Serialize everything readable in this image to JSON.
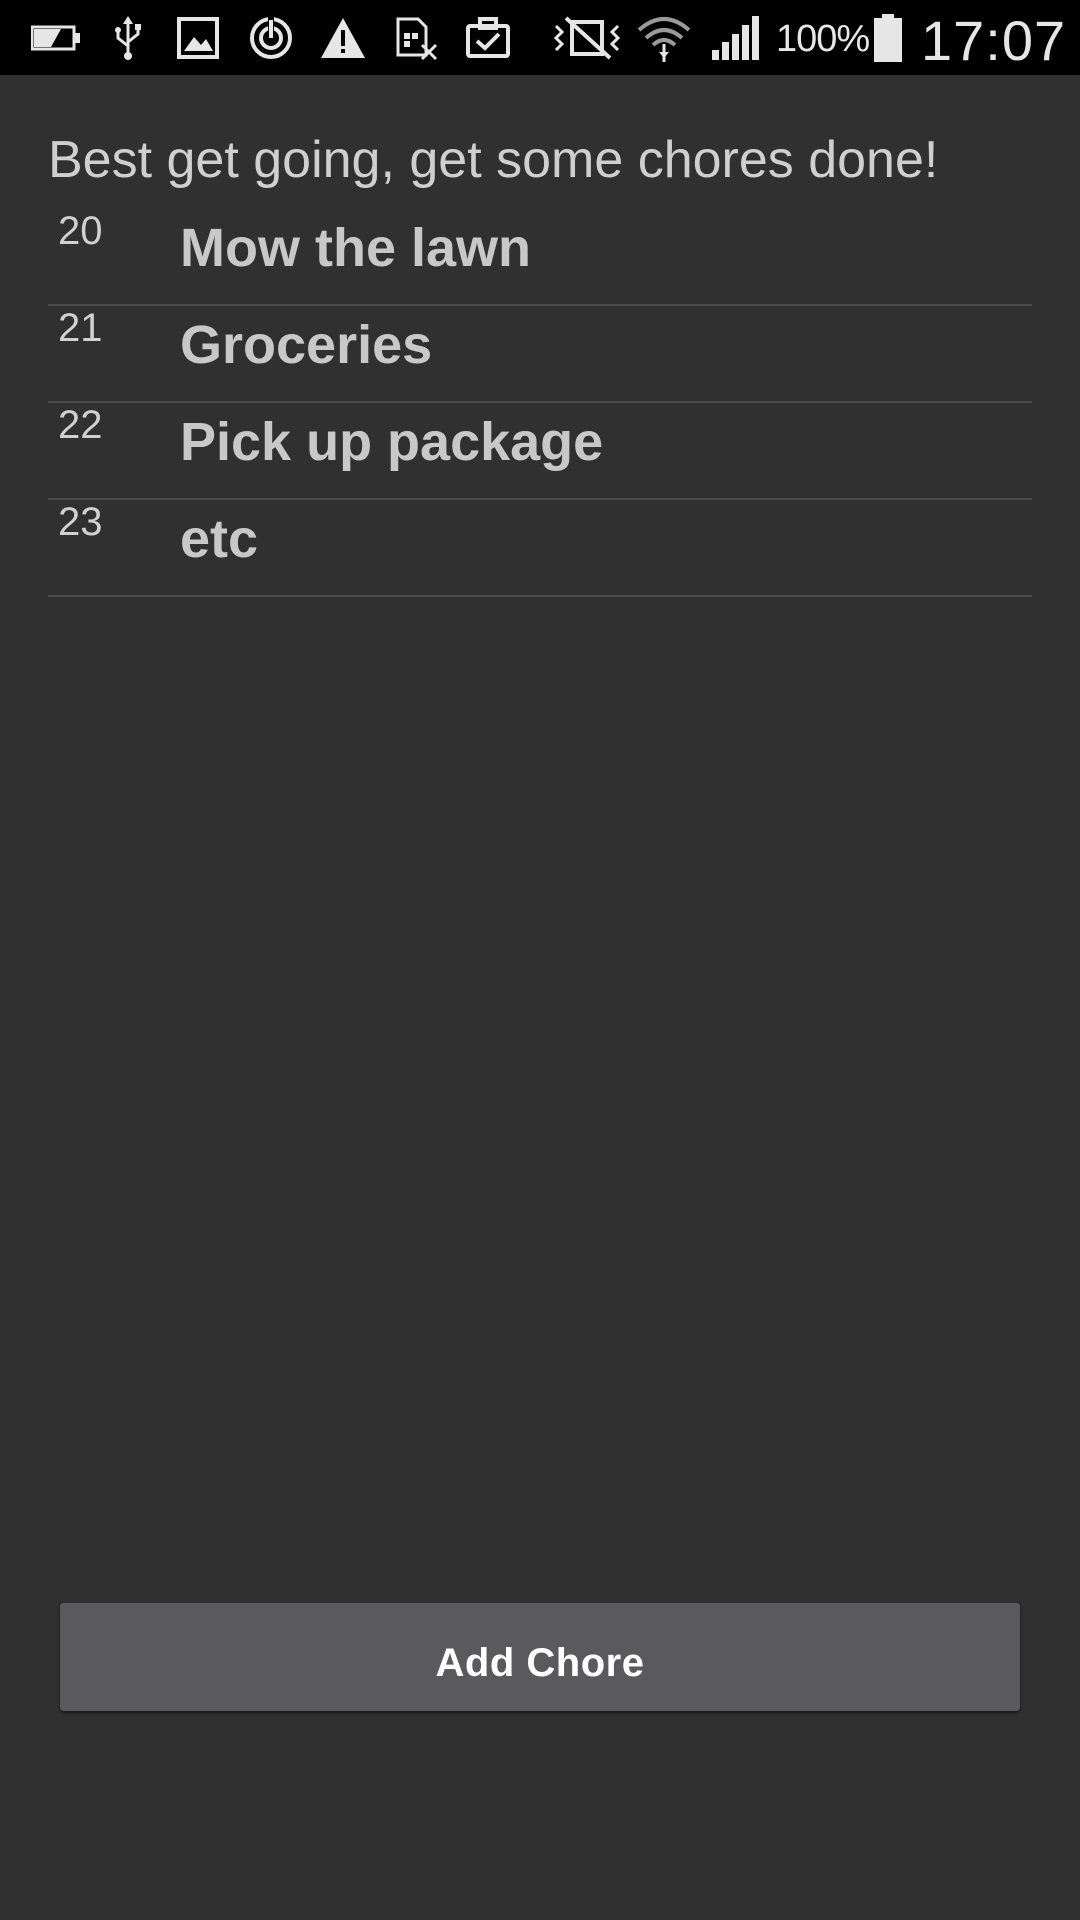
{
  "status_bar": {
    "battery_percent": "100%",
    "time": "17:07",
    "icons": [
      "battery-low-icon",
      "usb-icon",
      "image-icon",
      "sync-icon",
      "warning-icon",
      "sim-error-icon",
      "clipboard-check-icon",
      "vibrate-icon",
      "wifi-icon",
      "signal-icon",
      "battery-icon"
    ]
  },
  "header": {
    "text": "Best get going, get some chores done!"
  },
  "chores": [
    {
      "id": "20",
      "title": "Mow the lawn"
    },
    {
      "id": "21",
      "title": "Groceries"
    },
    {
      "id": "22",
      "title": "Pick up package"
    },
    {
      "id": "23",
      "title": "etc"
    }
  ],
  "actions": {
    "add_label": "Add Chore"
  },
  "colors": {
    "background": "#303030",
    "status_bar": "#000000",
    "button": "#5a5a5c",
    "divider": "#4a4a4a",
    "text": "#c8c8c8"
  }
}
